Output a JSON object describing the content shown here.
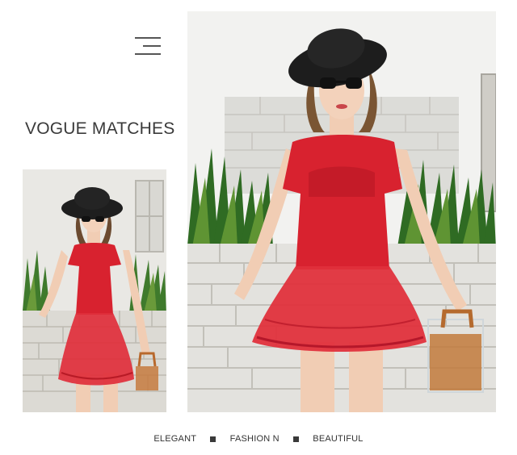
{
  "header": {
    "menu_icon": "menu-icon",
    "title": "VOGUE MATCHES"
  },
  "photos": [
    {
      "name": "model-photo-small",
      "subject": "model in red mesh one-piece swim dress with black straw hat and sunglasses"
    },
    {
      "name": "model-photo-large",
      "subject": "model in red mesh one-piece swim dress with black straw hat, sunglasses and clear handbag"
    }
  ],
  "footer": {
    "items": [
      "ELEGANT",
      "FASHION N",
      "BEAUTIFUL"
    ],
    "separator_icon": "square-bullet-icon"
  },
  "colors": {
    "dress_red": "#d8222f",
    "hat_black": "#1c1c1c",
    "text_dark": "#3a3a3a"
  }
}
